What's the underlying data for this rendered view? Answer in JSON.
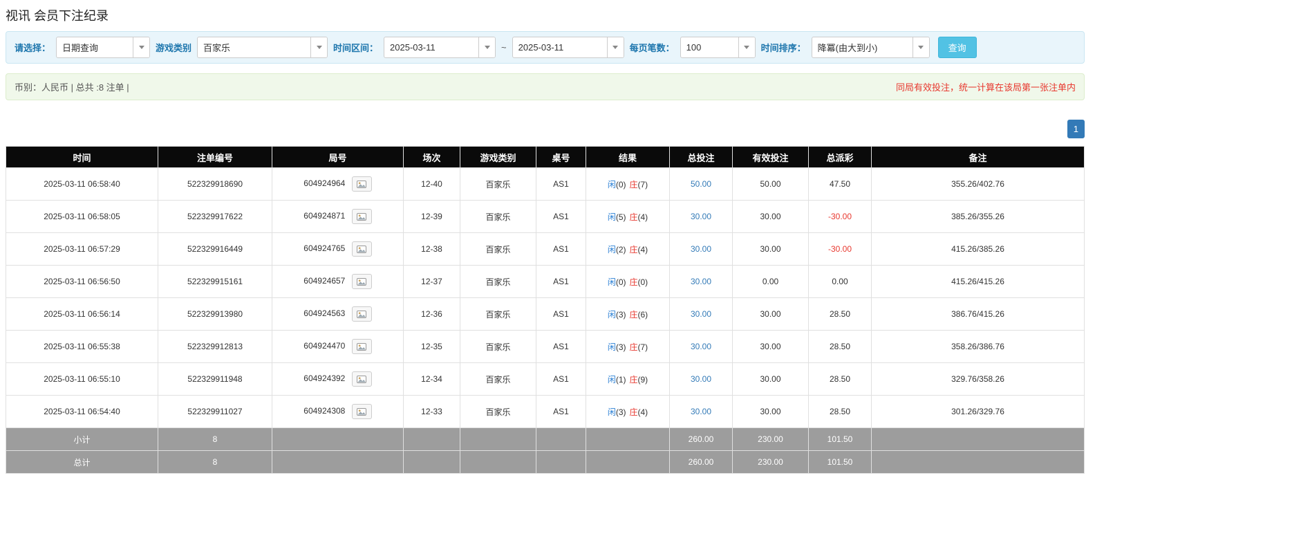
{
  "page": {
    "title": "视讯 会员下注纪录"
  },
  "filters": {
    "select_label": "请选择：",
    "select_value": "日期查询",
    "game_label": "游戏类别",
    "game_value": "百家乐",
    "range_label": "时间区间：",
    "date_from": "2025-03-11",
    "tilde": "~",
    "date_to": "2025-03-11",
    "page_size_label": "每页笔数：",
    "page_size_value": "100",
    "sort_label": "时间排序：",
    "sort_value": "降冪(由大到小)",
    "search_label": "查询"
  },
  "notice": {
    "left": "币别：人民币 | 总共 :8 注单 |",
    "right": "同局有效投注，统一计算在该局第一张注单内"
  },
  "pagination": {
    "page": "1"
  },
  "colors": {
    "accent_blue": "#337ab7",
    "player_blue": "#2a7fd4",
    "banker_red": "#e8382f",
    "header_black": "#0a0a0a",
    "footer_gray": "#9d9d9d"
  },
  "table": {
    "headers": [
      "时间",
      "注单编号",
      "局号",
      "场次",
      "游戏类别",
      "桌号",
      "结果",
      "总投注",
      "有效投注",
      "总派彩",
      "备注"
    ],
    "rows": [
      {
        "time": "2025-03-11 06:58:40",
        "bet_id": "522329918690",
        "round_id": "604924964",
        "session": "12-40",
        "game": "百家乐",
        "table_no": "AS1",
        "player": "闲",
        "player_score": "(0)",
        "banker": "庄",
        "banker_score": "(7)",
        "total_bet": "50.00",
        "valid_bet": "50.00",
        "payout": "47.50",
        "note": "355.26/402.76"
      },
      {
        "time": "2025-03-11 06:58:05",
        "bet_id": "522329917622",
        "round_id": "604924871",
        "session": "12-39",
        "game": "百家乐",
        "table_no": "AS1",
        "player": "闲",
        "player_score": "(5)",
        "banker": "庄",
        "banker_score": "(4)",
        "total_bet": "30.00",
        "valid_bet": "30.00",
        "payout": "-30.00",
        "note": "385.26/355.26"
      },
      {
        "time": "2025-03-11 06:57:29",
        "bet_id": "522329916449",
        "round_id": "604924765",
        "session": "12-38",
        "game": "百家乐",
        "table_no": "AS1",
        "player": "闲",
        "player_score": "(2)",
        "banker": "庄",
        "banker_score": "(4)",
        "total_bet": "30.00",
        "valid_bet": "30.00",
        "payout": "-30.00",
        "note": "415.26/385.26"
      },
      {
        "time": "2025-03-11 06:56:50",
        "bet_id": "522329915161",
        "round_id": "604924657",
        "session": "12-37",
        "game": "百家乐",
        "table_no": "AS1",
        "player": "闲",
        "player_score": "(0)",
        "banker": "庄",
        "banker_score": "(0)",
        "total_bet": "30.00",
        "valid_bet": "0.00",
        "payout": "0.00",
        "note": "415.26/415.26"
      },
      {
        "time": "2025-03-11 06:56:14",
        "bet_id": "522329913980",
        "round_id": "604924563",
        "session": "12-36",
        "game": "百家乐",
        "table_no": "AS1",
        "player": "闲",
        "player_score": "(3)",
        "banker": "庄",
        "banker_score": "(6)",
        "total_bet": "30.00",
        "valid_bet": "30.00",
        "payout": "28.50",
        "note": "386.76/415.26"
      },
      {
        "time": "2025-03-11 06:55:38",
        "bet_id": "522329912813",
        "round_id": "604924470",
        "session": "12-35",
        "game": "百家乐",
        "table_no": "AS1",
        "player": "闲",
        "player_score": "(3)",
        "banker": "庄",
        "banker_score": "(7)",
        "total_bet": "30.00",
        "valid_bet": "30.00",
        "payout": "28.50",
        "note": "358.26/386.76"
      },
      {
        "time": "2025-03-11 06:55:10",
        "bet_id": "522329911948",
        "round_id": "604924392",
        "session": "12-34",
        "game": "百家乐",
        "table_no": "AS1",
        "player": "闲",
        "player_score": "(1)",
        "banker": "庄",
        "banker_score": "(9)",
        "total_bet": "30.00",
        "valid_bet": "30.00",
        "payout": "28.50",
        "note": "329.76/358.26"
      },
      {
        "time": "2025-03-11 06:54:40",
        "bet_id": "522329911027",
        "round_id": "604924308",
        "session": "12-33",
        "game": "百家乐",
        "table_no": "AS1",
        "player": "闲",
        "player_score": "(3)",
        "banker": "庄",
        "banker_score": "(4)",
        "total_bet": "30.00",
        "valid_bet": "30.00",
        "payout": "28.50",
        "note": "301.26/329.76"
      }
    ],
    "subtotal": {
      "label": "小计",
      "count": "8",
      "total_bet": "260.00",
      "valid_bet": "230.00",
      "payout": "101.50"
    },
    "total": {
      "label": "总计",
      "count": "8",
      "total_bet": "260.00",
      "valid_bet": "230.00",
      "payout": "101.50"
    }
  }
}
